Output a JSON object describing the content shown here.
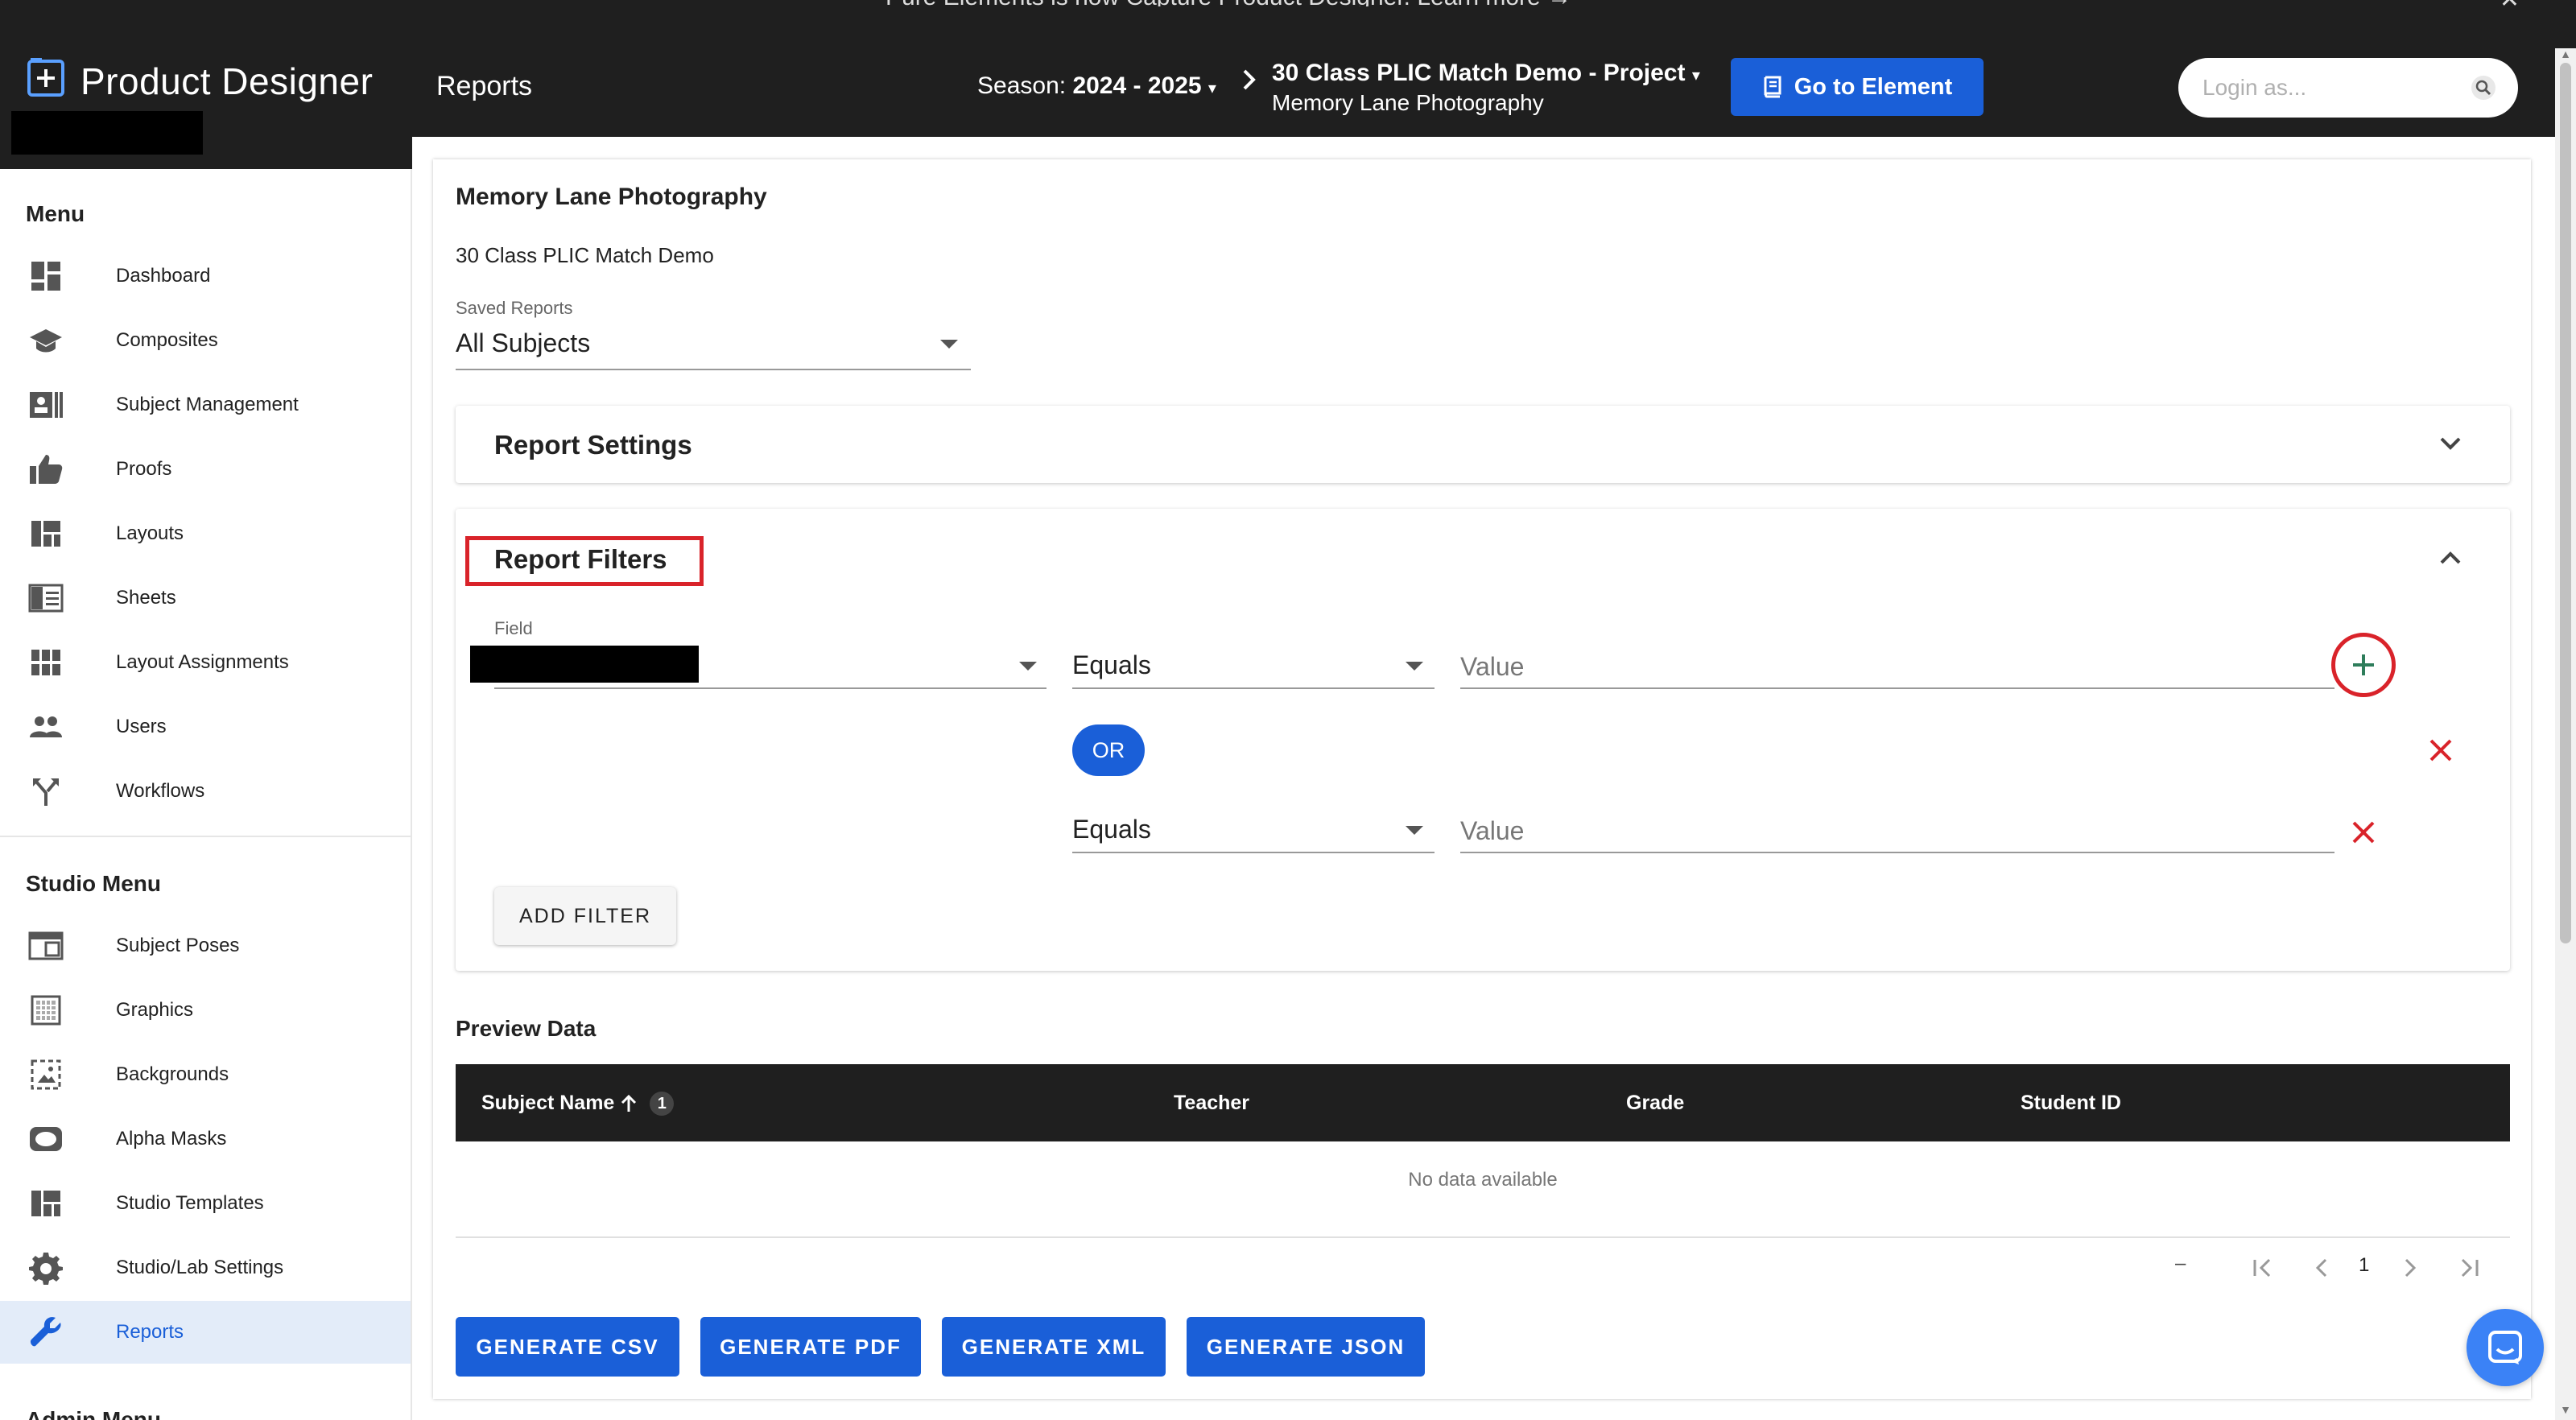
{
  "banner": {
    "text": "Pure Elements is now Capture Product Designer. Learn more →",
    "close": "✕"
  },
  "brand": {
    "name": "Product Designer"
  },
  "sidebar": {
    "menu_heading": "Menu",
    "items": [
      {
        "label": "Dashboard",
        "icon": "dashboard-icon"
      },
      {
        "label": "Composites",
        "icon": "graduation-cap-icon"
      },
      {
        "label": "Subject Management",
        "icon": "contact-card-icon"
      },
      {
        "label": "Proofs",
        "icon": "thumbs-up-icon"
      },
      {
        "label": "Layouts",
        "icon": "layout-icon"
      },
      {
        "label": "Sheets",
        "icon": "sheet-icon"
      },
      {
        "label": "Layout Assignments",
        "icon": "grid-icon"
      },
      {
        "label": "Users",
        "icon": "users-icon"
      },
      {
        "label": "Workflows",
        "icon": "workflow-icon"
      }
    ],
    "studio_heading": "Studio Menu",
    "studio_items": [
      {
        "label": "Subject Poses",
        "icon": "pose-frame-icon"
      },
      {
        "label": "Graphics",
        "icon": "graphics-icon"
      },
      {
        "label": "Backgrounds",
        "icon": "background-image-icon"
      },
      {
        "label": "Alpha Masks",
        "icon": "mask-icon"
      },
      {
        "label": "Studio Templates",
        "icon": "template-icon"
      },
      {
        "label": "Studio/Lab Settings",
        "icon": "gear-icon"
      },
      {
        "label": "Reports",
        "icon": "wrench-icon",
        "active": true
      }
    ],
    "admin_heading": "Admin Menu"
  },
  "header": {
    "page_title": "Reports",
    "season_label": "Season:",
    "season_value": "2024 - 2025",
    "project_title": "30 Class PLIC Match Demo - Project",
    "project_subtitle": "Memory Lane Photography",
    "goto_label": "Go to Element",
    "login_placeholder": "Login as..."
  },
  "main": {
    "company": "Memory Lane Photography",
    "project": "30 Class PLIC Match Demo",
    "saved_reports_label": "Saved Reports",
    "saved_reports_value": "All Subjects",
    "report_settings_title": "Report Settings",
    "report_filters_title": "Report Filters",
    "filters": {
      "field_label": "Field",
      "rows": [
        {
          "operator": "Equals",
          "value_placeholder": "Value"
        },
        {
          "operator": "Equals",
          "value_placeholder": "Value"
        }
      ],
      "or_label": "OR",
      "add_filter_label": "ADD FILTER"
    },
    "preview_title": "Preview Data",
    "table": {
      "columns": [
        "Subject Name",
        "Teacher",
        "Grade",
        "Student ID"
      ],
      "sort_badge": "1",
      "empty_text": "No data available",
      "pager_range": "–",
      "pager_page": "1"
    },
    "actions": [
      "GENERATE CSV",
      "GENERATE PDF",
      "GENERATE XML",
      "GENERATE JSON"
    ]
  },
  "colors": {
    "accent": "#1a5fd8",
    "dark": "#1f1f1f",
    "highlight": "#d9232a",
    "add": "#2e7d5b"
  }
}
